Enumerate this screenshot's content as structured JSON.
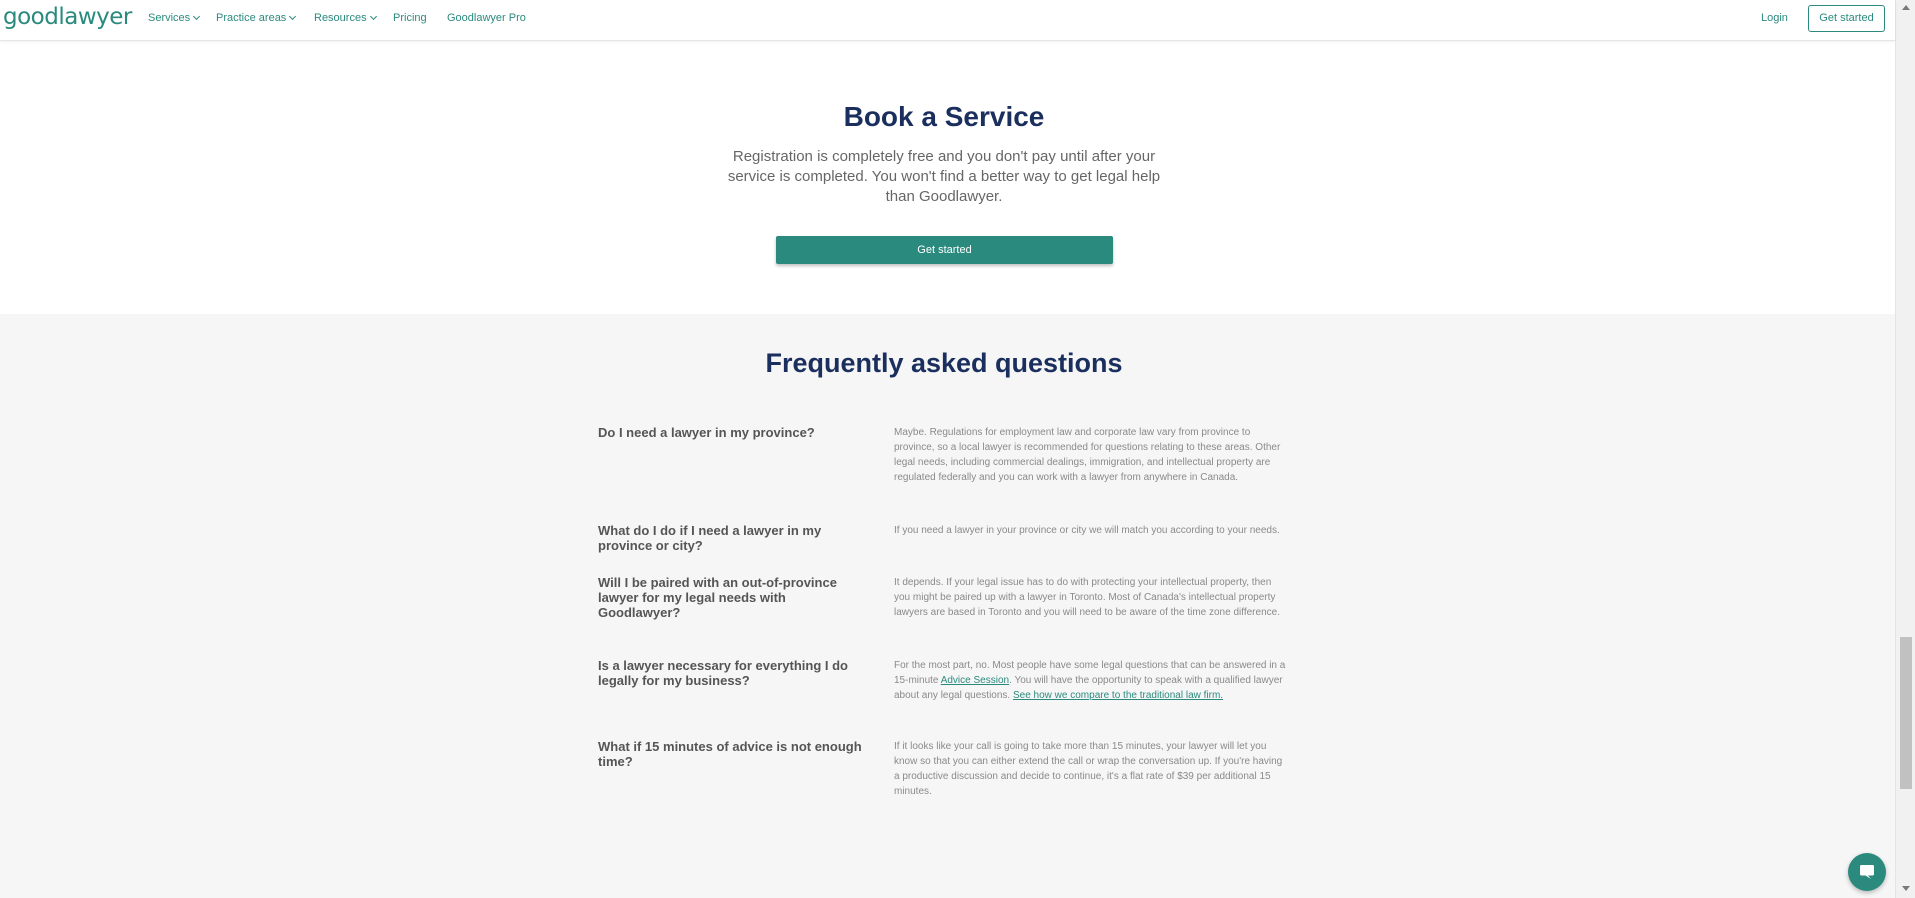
{
  "nav": {
    "logo": "goodlawyer",
    "items": [
      {
        "label": "Services",
        "has_dropdown": true
      },
      {
        "label": "Practice areas",
        "has_dropdown": true
      },
      {
        "label": "Resources",
        "has_dropdown": true
      },
      {
        "label": "Pricing",
        "has_dropdown": false
      },
      {
        "label": "Goodlawyer Pro",
        "has_dropdown": false
      }
    ],
    "login": "Login",
    "cta": "Get started"
  },
  "book": {
    "title": "Book a Service",
    "subtitle": "Registration is completely free and you don't pay until after your service is completed. You won't find a better way to get legal help than Goodlawyer.",
    "cta": "Get started"
  },
  "faq": {
    "title": "Frequently asked questions",
    "items": [
      {
        "question": "Do I need a lawyer in my province?",
        "answer": "Maybe. Regulations for employment law and corporate law vary from province to province, so a local lawyer is recommended for questions relating to these areas. Other legal needs, including commercial dealings, immigration, and intellectual property are regulated federally and you can work with a lawyer from anywhere in Canada."
      },
      {
        "question": "What do I do if I need a lawyer in my province or city?",
        "answer": "If you need a lawyer in your province or city we will match you according to your needs."
      },
      {
        "question": "Will I be paired with an out-of-province lawyer for my legal needs with Goodlawyer?",
        "answer": "It depends. If your legal issue has to do with protecting your intellectual property, then you might be paired up with a lawyer in Toronto. Most of Canada's intellectual property lawyers are based in Toronto and you will need to be aware of the time zone difference."
      },
      {
        "question": "Is a lawyer necessary for everything I do legally for my business?",
        "answer_part1": "For the most part, no. Most people have some legal questions that can be answered in a 15-minute ",
        "answer_link1": "Advice Session",
        "answer_part2": ". You will have the opportunity to speak with a qualified lawyer about any legal questions. ",
        "answer_link2": "See how we compare to the traditional law firm."
      },
      {
        "question": "What if 15 minutes of advice is not enough time?",
        "answer": "If it looks like your call is going to take more than 15 minutes, your lawyer will let you know so that you can either extend the call or wrap the conversation up. If you're having a productive discussion and decide to continue, it's a flat rate of $39 per additional 15 minutes."
      }
    ]
  },
  "icons": {
    "chat": "chat-bubble-icon",
    "dropdown": "chevron-down-icon"
  },
  "colors": {
    "brand": "#2b8a7e",
    "heading": "#1b2f5e",
    "faq_background": "#f6f6f6",
    "body_text": "#666666"
  }
}
